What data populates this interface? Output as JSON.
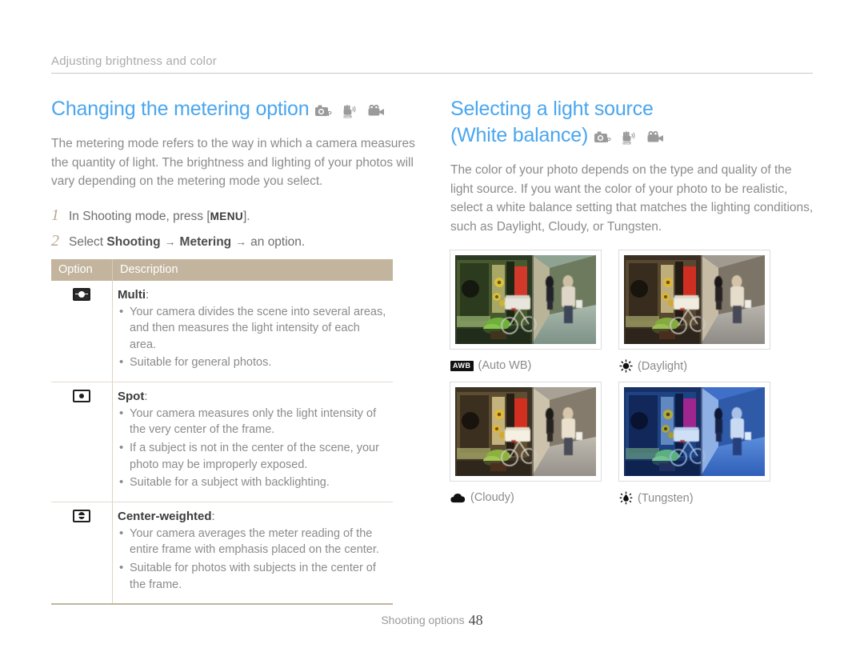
{
  "running_head": "Adjusting brightness and color",
  "left_column": {
    "title": "Changing the metering option",
    "mode_icons": [
      "program-mode-icon",
      "dual-is-mode-icon",
      "movie-mode-icon"
    ],
    "intro": "The metering mode refers to the way in which a camera measures the quantity of light. The brightness and lighting of your photos will vary depending on the metering mode you select.",
    "steps": [
      {
        "num": "1",
        "prefix": "In Shooting mode, press [",
        "key": "MENU",
        "suffix": "]."
      },
      {
        "num": "2",
        "prefix": "Select ",
        "bold1": "Shooting",
        "arrow1": "→",
        "bold2": "Metering",
        "arrow2": "→",
        "suffix": "an option."
      }
    ],
    "table": {
      "headers": [
        "Option",
        "Description"
      ],
      "rows": [
        {
          "icon": "multi-metering-icon",
          "title": "Multi",
          "bullets": [
            "Your camera divides the scene into several areas, and then measures the light intensity of each area.",
            "Suitable for general photos."
          ]
        },
        {
          "icon": "spot-metering-icon",
          "title": "Spot",
          "bullets": [
            "Your camera measures only the light intensity of the very center of the frame.",
            "If a subject is not in the center of the scene, your photo may be improperly exposed.",
            "Suitable for a subject with backlighting."
          ]
        },
        {
          "icon": "center-weighted-metering-icon",
          "title": "Center-weighted",
          "bullets": [
            "Your camera averages the meter reading of the entire frame with emphasis placed on the center.",
            "Suitable for photos with subjects in the center of the frame."
          ]
        }
      ]
    }
  },
  "right_column": {
    "title_line1": "Selecting a light source",
    "title_line2": "(White balance)",
    "mode_icons": [
      "program-mode-icon",
      "dual-is-mode-icon",
      "movie-mode-icon"
    ],
    "intro": "The color of your photo depends on the type and quality of the light source. If you want the color of your photo to be realistic, select a white balance setting that matches the lighting conditions, such as Daylight, Cloudy, or Tungsten.",
    "samples": [
      {
        "icon": "auto-wb-icon",
        "badge": "AWB",
        "caption": "(Auto WB)",
        "tint": "auto"
      },
      {
        "icon": "daylight-icon",
        "caption": "(Daylight)",
        "tint": "daylight"
      },
      {
        "icon": "cloudy-icon",
        "caption": "(Cloudy)",
        "tint": "cloudy"
      },
      {
        "icon": "tungsten-icon",
        "caption": "(Tungsten)",
        "tint": "tungsten"
      }
    ]
  },
  "footer": {
    "label": "Shooting options",
    "page": "48"
  },
  "colors": {
    "heading_blue": "#49a6ef",
    "table_header_tan": "#c3b49d",
    "step_number_tan": "#b9a892",
    "body_gray": "#8b8b8b",
    "rule_gray": "#c9c9c9"
  }
}
